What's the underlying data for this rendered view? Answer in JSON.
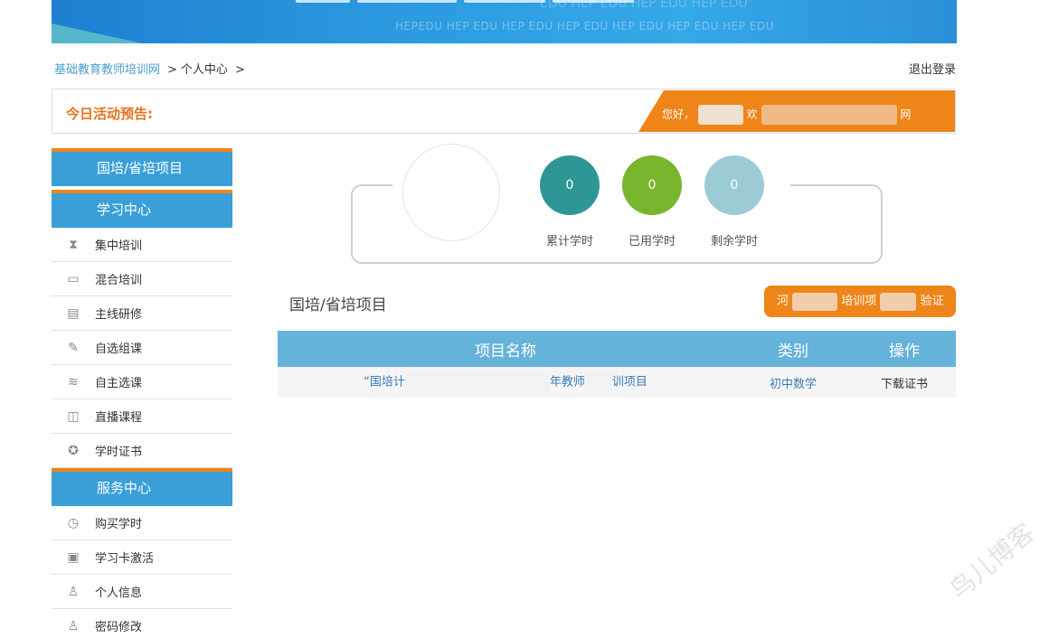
{
  "banner": {
    "watermark": "HEPEDU HEP EDU  HEP EDU  HEP EDU  HEP EDU  HEP EDU  HEP EDU",
    "watermark_top": "EDU  HEP EDU  HEP EDU  HEP EDU"
  },
  "breadcrumb": {
    "home": "基础教育教师培训网",
    "sep1": ">",
    "current": "个人中心",
    "sep2": ">"
  },
  "header": {
    "logout": "退出登录"
  },
  "notice": {
    "label": "今日活动预告:",
    "welcome_prefix": "您好，",
    "welcome_mid": "欢",
    "welcome_suffix": "网"
  },
  "sidebar": {
    "groups": [
      {
        "title": "国培/省培项目",
        "items": []
      },
      {
        "title": "学习中心",
        "items": [
          {
            "label": "集中培训",
            "icon": "hourglass-icon",
            "glyph": "⧗"
          },
          {
            "label": "混合培训",
            "icon": "monitor-icon",
            "glyph": "▭"
          },
          {
            "label": "主线研修",
            "icon": "clipboard-icon",
            "glyph": "▤"
          },
          {
            "label": "自选组课",
            "icon": "edit-icon",
            "glyph": "✎"
          },
          {
            "label": "自主选课",
            "icon": "layers-icon",
            "glyph": "≋"
          },
          {
            "label": "直播课程",
            "icon": "video-camera-icon",
            "glyph": "◫"
          },
          {
            "label": "学时证书",
            "icon": "award-icon",
            "glyph": "✪"
          }
        ]
      },
      {
        "title": "服务中心",
        "items": [
          {
            "label": "购买学时",
            "icon": "clock-icon",
            "glyph": "◷"
          },
          {
            "label": "学习卡激活",
            "icon": "card-icon",
            "glyph": "▣"
          },
          {
            "label": "个人信息",
            "icon": "user-icon",
            "glyph": "♙"
          },
          {
            "label": "密码修改",
            "icon": "lock-icon",
            "glyph": "♙"
          }
        ]
      }
    ]
  },
  "stats": [
    {
      "value": "0",
      "label": "累计学时",
      "color": "#2e9796"
    },
    {
      "value": "0",
      "label": "已用学时",
      "color": "#7ab52e"
    },
    {
      "value": "0",
      "label": "剩余学时",
      "color": "#9ccbd6"
    }
  ],
  "section": {
    "title": "国培/省培项目",
    "verify_prefix": "河",
    "verify_mid": "培训项",
    "verify_suffix": "验证"
  },
  "table": {
    "headers": [
      "项目名称",
      "类别",
      "操作"
    ],
    "rows": [
      {
        "name_prefix": "“国培计",
        "name_suffix": "年教师",
        "name_end": "训项目",
        "category": "初中数学",
        "action": "下载证书"
      }
    ]
  },
  "watermark": "鸟儿博客"
}
